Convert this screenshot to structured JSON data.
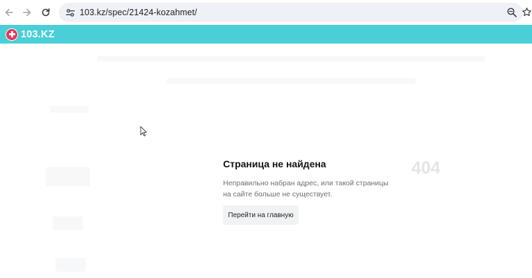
{
  "browser": {
    "url": "103.kz/spec/21424-kozahmet/",
    "icons": {
      "back": "arrow-left-icon",
      "forward": "arrow-right-icon",
      "reload": "reload-icon",
      "site_info": "tune-icon",
      "zoom": "zoom-icon",
      "bookmark": "star-icon"
    }
  },
  "site": {
    "logo_text": "103.KZ",
    "header_color": "#48cfd8",
    "logo_color": "#e8355b"
  },
  "error_page": {
    "title": "Страница не найдена",
    "code": "404",
    "description": "Неправильно набран адрес, или такой страницы на сайте больше не существует.",
    "home_button_label": "Перейти на главную"
  }
}
